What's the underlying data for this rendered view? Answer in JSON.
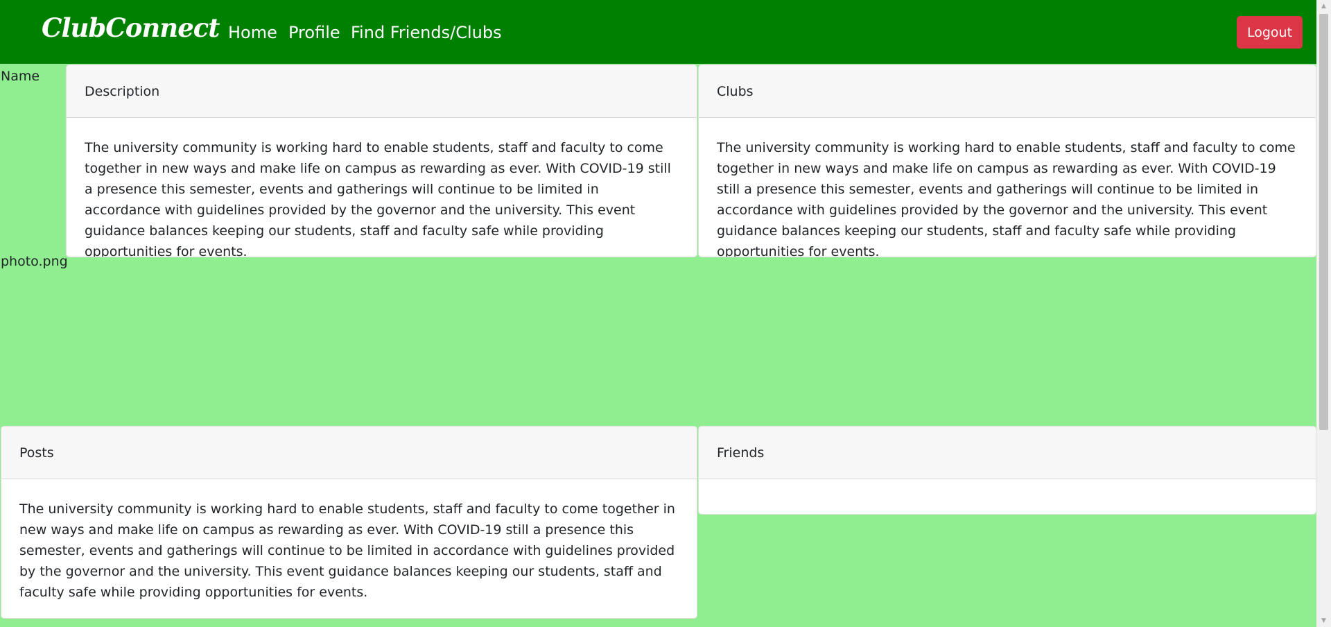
{
  "navbar": {
    "brand": "ClubConnect",
    "links": [
      {
        "label": "Home"
      },
      {
        "label": "Profile"
      },
      {
        "label": "Find Friends/Clubs"
      }
    ],
    "logout_label": "Logout"
  },
  "profile": {
    "name_label": "Name",
    "photo_label": "photo.png"
  },
  "cards": {
    "description": {
      "title": "Description",
      "body": "The university community is working hard to enable students, staff and faculty to come together in new ways and make life on campus as rewarding as ever. With COVID-19 still a presence this semester, events and gatherings will continue to be limited in accordance with guidelines provided by the governor and the university. This event guidance balances keeping our students, staff and faculty safe while providing opportunities for events."
    },
    "clubs": {
      "title": "Clubs",
      "body": "The university community is working hard to enable students, staff and faculty to come together in new ways and make life on campus as rewarding as ever. With COVID-19 still a presence this semester, events and gatherings will continue to be limited in accordance with guidelines provided by the governor and the university. This event guidance balances keeping our students, staff and faculty safe while providing opportunities for events."
    },
    "posts": {
      "title": "Posts",
      "body": "The university community is working hard to enable students, staff and faculty to come together in new ways and make life on campus as rewarding as ever. With COVID-19 still a presence this semester, events and gatherings will continue to be limited in accordance with guidelines provided by the governor and the university. This event guidance balances keeping our students, staff and faculty safe while providing opportunities for events."
    },
    "friends": {
      "title": "Friends",
      "body": ""
    }
  },
  "colors": {
    "navbar": "#008000",
    "page_background": "#90ee90",
    "logout_button": "#dc3545",
    "card_header": "#f7f7f7"
  },
  "icons": {
    "scroll_up": "scroll-up-arrow-icon",
    "scroll_down": "scroll-down-arrow-icon"
  }
}
